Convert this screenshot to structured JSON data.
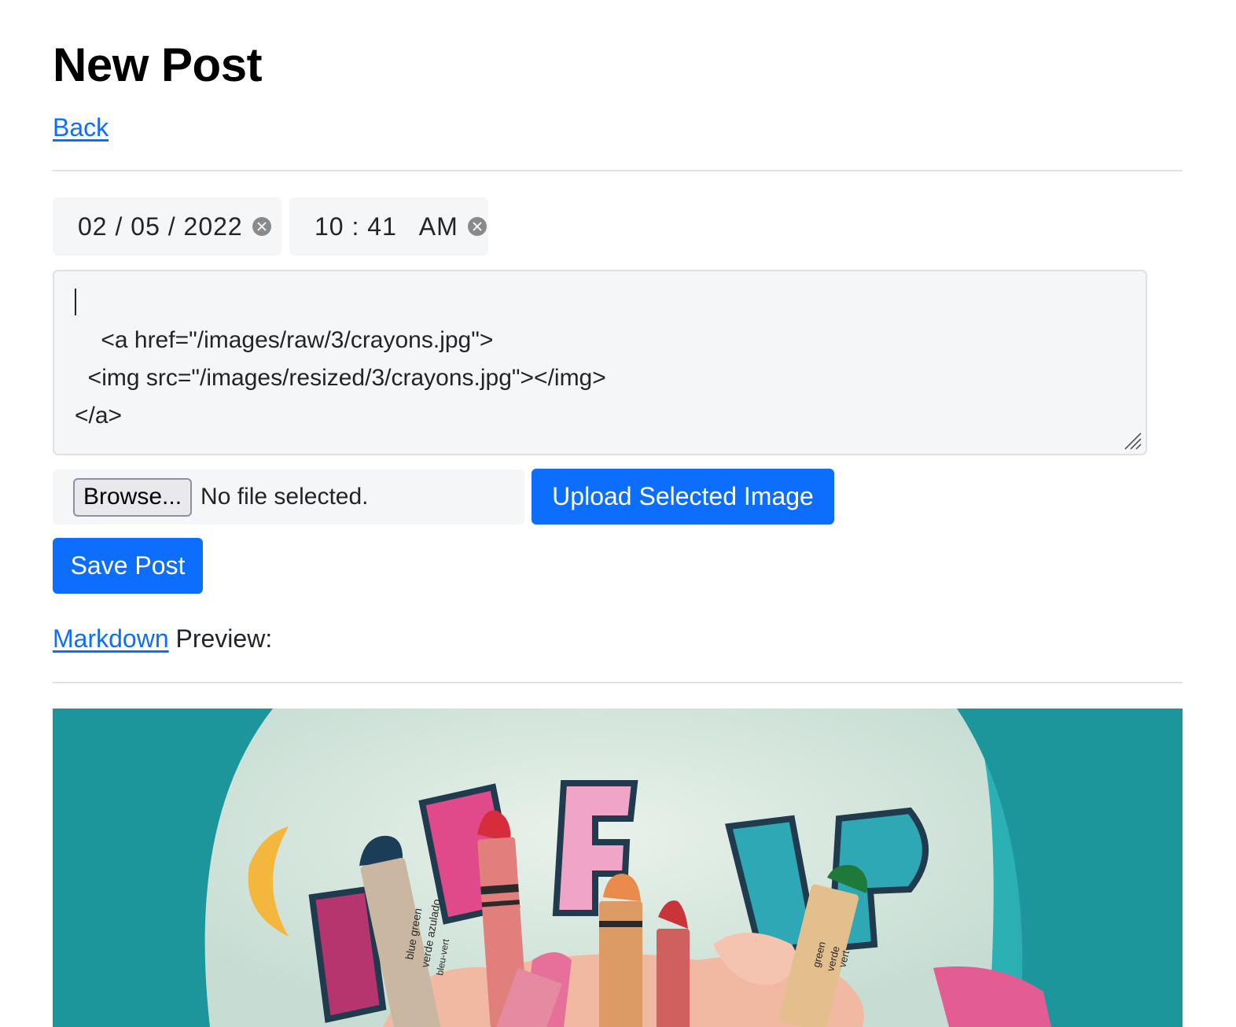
{
  "page": {
    "title": "New Post",
    "back_link": "Back"
  },
  "post_form": {
    "date_value": "02 / 05 / 2022",
    "time_value": "10 : 41   AM",
    "body_value": "<a href=\"/images/raw/3/crayons.jpg\">\n  <img src=\"/images/resized/3/crayons.jpg\"></img>\n</a>",
    "browse_label": "Browse...",
    "file_status": "No file selected.",
    "upload_button": "Upload Selected Image",
    "save_button": "Save Post"
  },
  "preview": {
    "link_label": "Markdown",
    "label": "Preview:",
    "crayon_labels": {
      "blue_green": "blue green",
      "verde_azulado": "verde azulado",
      "bleu_vert": "bleu-vert",
      "green": "green",
      "verde": "verde",
      "vert": "vert"
    }
  },
  "colors": {
    "accent": "#0d6efd",
    "input_bg": "#f5f6f8",
    "rule": "#dee2e6"
  },
  "icons": {
    "clear": "clear-icon",
    "resize": "resize-grip-icon"
  }
}
